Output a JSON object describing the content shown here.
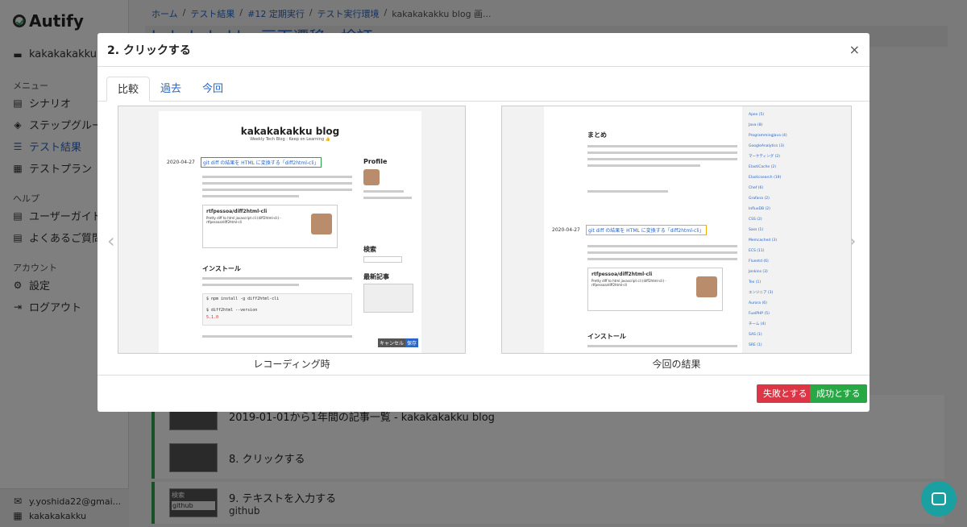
{
  "app": {
    "name": "Autify"
  },
  "sidebar": {
    "project": "kakakakakku",
    "menu_head": "メニュー",
    "items": [
      {
        "label": "シナリオ"
      },
      {
        "label": "ステップグループ"
      },
      {
        "label": "テスト結果"
      },
      {
        "label": "テストプラン"
      }
    ],
    "help_head": "ヘルプ",
    "help_items": [
      {
        "label": "ユーザーガイド"
      },
      {
        "label": "よくあるご質問"
      }
    ],
    "account_head": "アカウント",
    "account_items": [
      {
        "label": "設定"
      },
      {
        "label": "ログアウト"
      }
    ],
    "user_email": "y.yoshida22@gmai...",
    "user_org": "kakakakakku"
  },
  "breadcrumb": [
    "ホーム",
    "テスト結果",
    "#12 定期実行",
    "テスト実行環境",
    "kakakakakku blog 画..."
  ],
  "page_title": "kakakakakku 画面遷移 · 検証",
  "steps": [
    {
      "label": "2019-01-01から1年間の記事一覧 - kakakakakku blog"
    },
    {
      "label": "8. クリックする"
    },
    {
      "label": "9. テキストを入力する",
      "sub": "github",
      "thumb_label": "検索",
      "thumb_input": "github"
    }
  ],
  "modal": {
    "title": "2. クリックする",
    "close": "×",
    "tabs": [
      "比較",
      "過去",
      "今回"
    ],
    "left_caption": "レコーディング時",
    "right_caption": "今回の結果",
    "prev": "‹",
    "next": "›",
    "fail_button": "失敗とする",
    "success_button": "成功とする"
  },
  "left_shot": {
    "blog_title": "kakakakakku blog",
    "blog_sub": "Weekly Tech Blog : Keep on Learning 👍",
    "date": "2020-04-27",
    "link": "git diff の結果を HTML に変換する「diff2html-cli」",
    "profile": "Profile",
    "card_title": "rtfpessoa/diff2html-cli",
    "card_sub": "Pretty diff to html javascript cli (diff2html-cli) - rtfpessoa/diff2html-cli",
    "install": "インストール",
    "search": "検索",
    "recent": "最新記事",
    "code1": "$ npm install -g diff2html-cli",
    "code2": "$ diff2html --version",
    "code3": "5.1.0",
    "cancel": "キャンセル",
    "save": "保存"
  },
  "right_shot": {
    "summary": "まとめ",
    "date": "2020-04-27",
    "link": "git diff の結果を HTML に変換する「diff2html-cli」",
    "card_title": "rtfpessoa/diff2html-cli",
    "card_sub": "Pretty diff to html javascript cli (diff2html-cli) - rtfpessoa/diff2html-cli",
    "install": "インストール",
    "links": [
      "Apex (5)",
      "Java (8)",
      "ProgrammingJava (4)",
      "GoogleAnalytics (3)",
      "マーケティング (2)",
      "ElastiCache (2)",
      "Elasticsearch (19)",
      "Chef (6)",
      "Grafana (2)",
      "InfluxDB (2)",
      "CSS (2)",
      "Sass (1)",
      "Memcached (3)",
      "ECS (11)",
      "Fluentd (6)",
      "Jenkins (3)",
      "Tex (1)",
      "エンジニア (3)",
      "Aurora (6)",
      "FuelPHP (5)",
      "チーム (4)",
      "SAS (1)",
      "SRE (1)"
    ]
  },
  "colors": {
    "accent": "#2a66c7",
    "success": "#28a745",
    "danger": "#dc3545",
    "step_border": "#2ea44f"
  }
}
